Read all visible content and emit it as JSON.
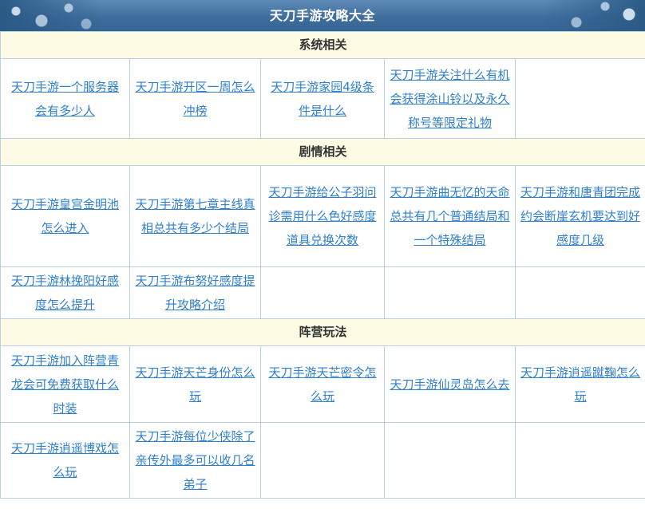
{
  "page_title": "天刀手游攻略大全",
  "sections": [
    {
      "name": "系统相关",
      "rows": [
        [
          "天刀手游一个服务器会有多少人",
          "天刀手游开区一周怎么冲榜",
          "天刀手游家园4级条件是什么",
          "天刀手游关注什么有机会获得涂山铃以及永久称号等限定礼物",
          ""
        ]
      ]
    },
    {
      "name": "剧情相关",
      "rows": [
        [
          "天刀手游皇宫金明池怎么进入",
          "天刀手游第七章主线真相总共有多少个结局",
          "天刀手游给公子羽问诊需用什么色好感度道具兑换次数",
          "天刀手游曲无忆的天命总共有几个普通结局和一个特殊结局",
          "天刀手游和唐青团完成约会断崖玄机要达到好感度几级"
        ],
        [
          "天刀手游林挽阳好感度怎么提升",
          "天刀手游布努好感度提升攻略介绍",
          "",
          "",
          ""
        ]
      ]
    },
    {
      "name": "阵营玩法",
      "rows": [
        [
          "天刀手游加入阵营青龙会可免费获取什么时装",
          "天刀手游天芒身份怎么玩",
          "天刀手游天芒密令怎么玩",
          "天刀手游仙灵岛怎么去",
          "天刀手游逍遥蹴鞠怎么玩"
        ],
        [
          "天刀手游逍遥博戏怎么玩",
          "天刀手游每位少侠除了亲传外最多可以收几名弟子",
          "",
          "",
          ""
        ]
      ]
    }
  ]
}
